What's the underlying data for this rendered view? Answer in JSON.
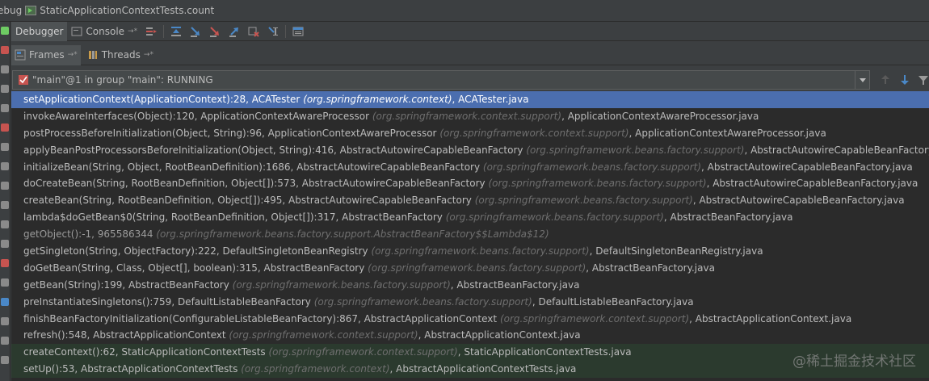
{
  "titlebar": {
    "prefix": "ebug",
    "config_name": "StaticApplicationContextTests.count"
  },
  "toolbar": {
    "tabs": [
      {
        "label": "Debugger",
        "active": true
      },
      {
        "label": "Console",
        "active": false
      }
    ],
    "icons": [
      "show-execution-point-icon",
      "step-over-icon",
      "step-into-icon",
      "force-step-into-icon",
      "step-out-icon",
      "drop-frame-icon",
      "run-to-cursor-icon",
      "evaluate-expression-icon"
    ]
  },
  "subtabs": {
    "frames_label": "Frames",
    "threads_label": "Threads"
  },
  "thread_selector": {
    "value": "\"main\"@1 in group \"main\": RUNNING"
  },
  "frames": [
    {
      "method": "setApplicationContext(ApplicationContext):28, ACATester",
      "package": "(org.springframework.context)",
      "file": "ACATester.java",
      "state": "selected"
    },
    {
      "method": "invokeAwareInterfaces(Object):120, ApplicationContextAwareProcessor",
      "package": "(org.springframework.context.support)",
      "file": "ApplicationContextAwareProcessor.java",
      "state": ""
    },
    {
      "method": "postProcessBeforeInitialization(Object, String):96, ApplicationContextAwareProcessor",
      "package": "(org.springframework.context.support)",
      "file": "ApplicationContextAwareProcessor.java",
      "state": ""
    },
    {
      "method": "applyBeanPostProcessorsBeforeInitialization(Object, String):416, AbstractAutowireCapableBeanFactory",
      "package": "(org.springframework.beans.factory.support)",
      "file": "AbstractAutowireCapableBeanFactory.java",
      "state": ""
    },
    {
      "method": "initializeBean(String, Object, RootBeanDefinition):1686, AbstractAutowireCapableBeanFactory",
      "package": "(org.springframework.beans.factory.support)",
      "file": "AbstractAutowireCapableBeanFactory.java",
      "state": ""
    },
    {
      "method": "doCreateBean(String, RootBeanDefinition, Object[]):573, AbstractAutowireCapableBeanFactory",
      "package": "(org.springframework.beans.factory.support)",
      "file": "AbstractAutowireCapableBeanFactory.java",
      "state": ""
    },
    {
      "method": "createBean(String, RootBeanDefinition, Object[]):495, AbstractAutowireCapableBeanFactory",
      "package": "(org.springframework.beans.factory.support)",
      "file": "AbstractAutowireCapableBeanFactory.java",
      "state": ""
    },
    {
      "method": "lambda$doGetBean$0(String, RootBeanDefinition, Object[]):317, AbstractBeanFactory",
      "package": "(org.springframework.beans.factory.support)",
      "file": "AbstractBeanFactory.java",
      "state": ""
    },
    {
      "method": "getObject():-1, 965586344",
      "package": "(org.springframework.beans.factory.support.AbstractBeanFactory$$Lambda$12)",
      "file": "",
      "state": "dim"
    },
    {
      "method": "getSingleton(String, ObjectFactory):222, DefaultSingletonBeanRegistry",
      "package": "(org.springframework.beans.factory.support)",
      "file": "DefaultSingletonBeanRegistry.java",
      "state": ""
    },
    {
      "method": "doGetBean(String, Class, Object[], boolean):315, AbstractBeanFactory",
      "package": "(org.springframework.beans.factory.support)",
      "file": "AbstractBeanFactory.java",
      "state": ""
    },
    {
      "method": "getBean(String):199, AbstractBeanFactory",
      "package": "(org.springframework.beans.factory.support)",
      "file": "AbstractBeanFactory.java",
      "state": ""
    },
    {
      "method": "preInstantiateSingletons():759, DefaultListableBeanFactory",
      "package": "(org.springframework.beans.factory.support)",
      "file": "DefaultListableBeanFactory.java",
      "state": ""
    },
    {
      "method": "finishBeanFactoryInitialization(ConfigurableListableBeanFactory):867, AbstractApplicationContext",
      "package": "(org.springframework.context.support)",
      "file": "AbstractApplicationContext.java",
      "state": ""
    },
    {
      "method": "refresh():548, AbstractApplicationContext",
      "package": "(org.springframework.context.support)",
      "file": "AbstractApplicationContext.java",
      "state": ""
    },
    {
      "method": "createContext():62, StaticApplicationContextTests",
      "package": "(org.springframework.context.support)",
      "file": "StaticApplicationContextTests.java",
      "state": "lib"
    },
    {
      "method": "setUp():53, AbstractApplicationContextTests",
      "package": "(org.springframework.context)",
      "file": "AbstractApplicationContextTests.java",
      "state": "lib"
    }
  ],
  "watermark": "@稀土掘金技术社区",
  "colors": {
    "selected": "#4b6eaf",
    "background": "#2b2b2b",
    "panel": "#3c3f41"
  }
}
